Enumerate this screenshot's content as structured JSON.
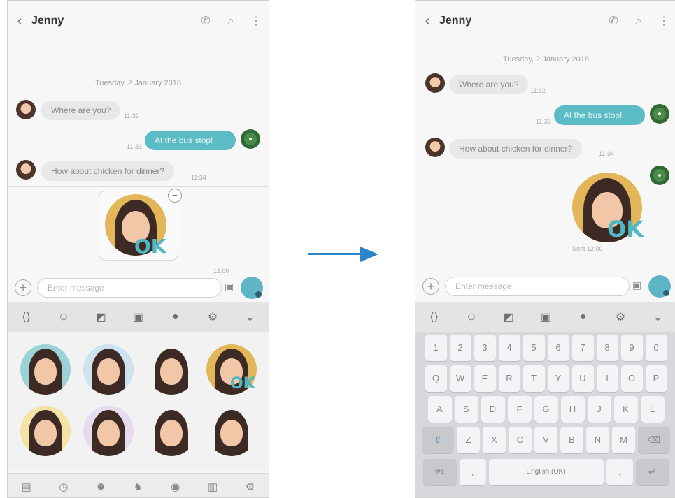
{
  "left_screen": {
    "contact_name": "Jenny",
    "date_label": "Tuesday, 2 January 2018",
    "messages": [
      {
        "text": "Where are you?",
        "time": "11:32",
        "direction": "in"
      },
      {
        "text": "At the bus stop!",
        "time": "11:33",
        "direction": "out"
      },
      {
        "text": "How about chicken for dinner?",
        "time": "11:34",
        "direction": "in"
      }
    ],
    "input_placeholder": "Enter message",
    "attach_time": "12:00"
  },
  "right_screen": {
    "contact_name": "Jenny",
    "date_label": "Tuesday, 2 January 2018",
    "messages": [
      {
        "text": "Where are you?",
        "time": "11:32",
        "direction": "in"
      },
      {
        "text": "At the bus stop!",
        "time": "11:33",
        "direction": "out"
      },
      {
        "text": "How about chicken for dinner?",
        "time": "11:34",
        "direction": "in"
      }
    ],
    "sticker_time": "Sent 12:00",
    "input_placeholder": "Enter message",
    "keyboard": {
      "row1": [
        "1",
        "2",
        "3",
        "4",
        "5",
        "6",
        "7",
        "8",
        "9",
        "0"
      ],
      "row2": [
        "Q",
        "W",
        "E",
        "R",
        "T",
        "Y",
        "U",
        "I",
        "O",
        "P"
      ],
      "row3": [
        "A",
        "S",
        "D",
        "F",
        "G",
        "H",
        "J",
        "K",
        "L"
      ],
      "row4": [
        "Z",
        "X",
        "C",
        "V",
        "B",
        "N",
        "M"
      ],
      "space_label": "English (UK)",
      "sym_label": "!#1",
      "comma": ",",
      "period": "."
    }
  },
  "sticker_ok_text": "OK",
  "colors": {
    "outgoing_bubble": "#5bbcc6",
    "arrow": "#2b86c9",
    "sticker_bg": "#e3b65a"
  },
  "icons": {
    "header": [
      "back-icon",
      "phone-icon",
      "search-icon",
      "more-icon"
    ],
    "toolbar": [
      "gif-icon",
      "emoji-icon",
      "sticker-icon",
      "image-icon",
      "mic-icon",
      "settings-icon",
      "collapse-icon"
    ],
    "bottom_tabs": [
      "keyboard-icon",
      "recent-icon",
      "avatar-tab-icon",
      "animal-icon",
      "cat-icon",
      "bag-icon",
      "settings-icon"
    ]
  }
}
